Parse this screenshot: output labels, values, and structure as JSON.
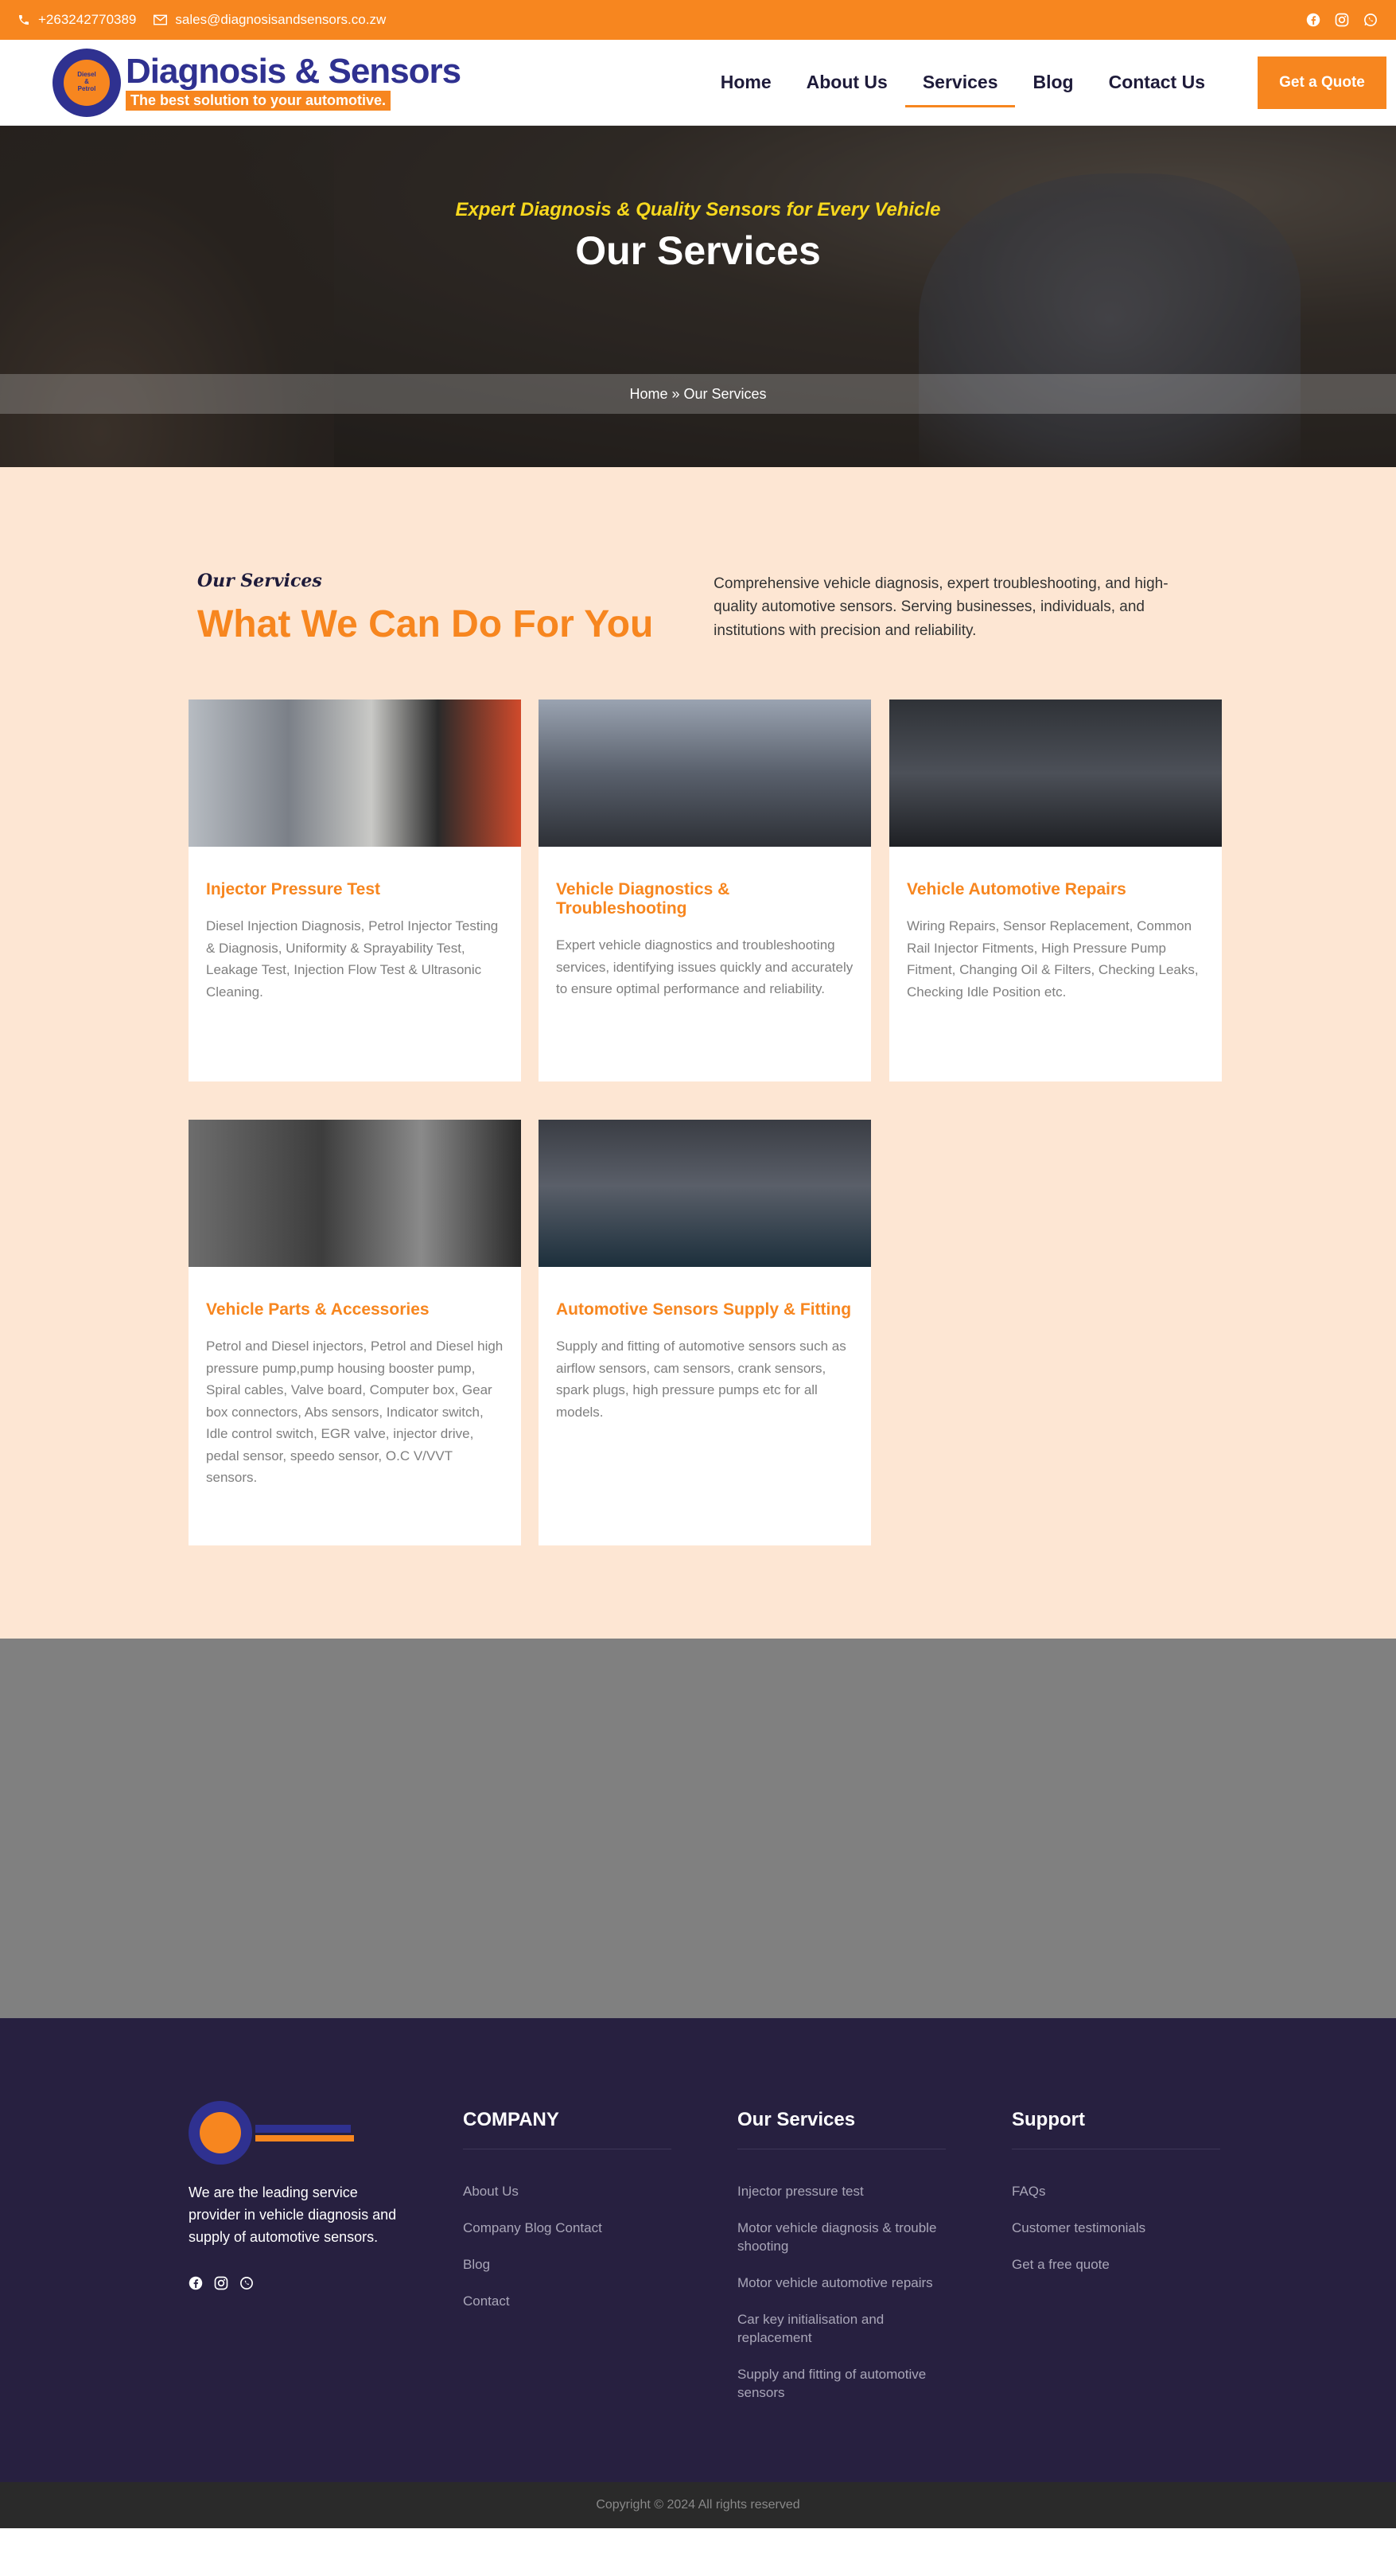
{
  "topbar": {
    "phone": "+263242770389",
    "email": "sales@diagnosisandsensors.co.zw",
    "socials": [
      "facebook-icon",
      "instagram-icon",
      "whatsapp-icon"
    ],
    "color": "#f7861f"
  },
  "header": {
    "logo_title": "Diagnosis & Sensors",
    "logo_tagline": "The best solution to your automotive.",
    "nav": [
      "Home",
      "About Us",
      "Services",
      "Blog",
      "Contact Us"
    ],
    "active_nav": "Services",
    "quote_button": "Get a Quote"
  },
  "hero": {
    "subtitle": "Expert Diagnosis & Quality Sensors for Every Vehicle",
    "title": "Our Services",
    "breadcrumb": "Home » Our Services"
  },
  "services": {
    "eyebrow": "Our Services",
    "heading": "What We Can Do For You",
    "intro": "Comprehensive vehicle diagnosis, expert troubleshooting, and high-quality automotive sensors. Serving businesses, individuals, and institutions with precision and reliability.",
    "cards": [
      {
        "title": "Injector Pressure Test",
        "desc": "Diesel Injection Diagnosis, Petrol Injector Testing & Diagnosis, Uniformity & Sprayability Test, Leakage Test, Injection Flow Test & Ultrasonic Cleaning."
      },
      {
        "title": "Vehicle Diagnostics & Troubleshooting",
        "desc": "Expert vehicle diagnostics and troubleshooting services, identifying issues quickly and accurately to ensure optimal performance and reliability."
      },
      {
        "title": "Vehicle Automotive Repairs",
        "desc": "Wiring Repairs, Sensor Replacement, Common Rail Injector Fitments, High Pressure Pump Fitment, Changing Oil & Filters, Checking Leaks, Checking Idle Position etc."
      },
      {
        "title": "Vehicle Parts & Accessories",
        "desc": "Petrol and Diesel injectors, Petrol and Diesel high pressure pump,pump housing booster pump, Spiral cables, Valve board, Computer box, Gear box connectors, Abs sensors, Indicator switch, Idle control switch, EGR valve, injector drive, pedal sensor, speedo sensor, O.C V/VVT sensors."
      },
      {
        "title": "Automotive Sensors Supply & Fitting",
        "desc": "Supply and fitting of automotive sensors such as airflow sensors, cam sensors, crank sensors, spark plugs, high pressure pumps etc for all models."
      }
    ]
  },
  "footer": {
    "about": "We are the leading service provider in vehicle diagnosis and supply of automotive sensors.",
    "company": {
      "heading": "COMPANY",
      "links": [
        "About Us",
        "Company Blog Contact",
        "Blog",
        "Contact"
      ]
    },
    "our_services": {
      "heading": "Our Services",
      "links": [
        "Injector pressure test",
        "Motor vehicle diagnosis & trouble shooting",
        "Motor vehicle automotive repairs",
        "Car key initialisation and replacement",
        "Supply and fitting of automotive sensors"
      ]
    },
    "support": {
      "heading": "Support",
      "links": [
        "FAQs",
        "Customer testimonials",
        "Get a free quote"
      ]
    },
    "copyright": "Copyright © 2024 All rights reserved"
  }
}
